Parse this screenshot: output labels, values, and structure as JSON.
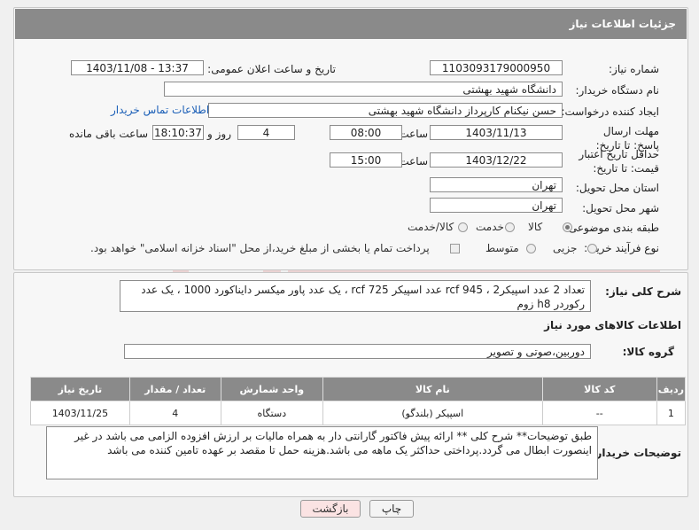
{
  "header": {
    "title": "جزئیات اطلاعات نیاز"
  },
  "fields": {
    "need_number_label": "شماره نیاز:",
    "need_number": "1103093179000950",
    "announce_label": "تاریخ و ساعت اعلان عمومی:",
    "announce_value": "1403/11/08 - 13:37",
    "buyer_label": "نام دستگاه خریدار:",
    "buyer_value": "دانشگاه شهید بهشتی",
    "creator_label": "ایجاد کننده درخواست:",
    "creator_value": "حسن نیکنام کارپرداز دانشگاه شهید بهشتی",
    "contact_link": "اطلاعات تماس خریدار",
    "deadline_label": "مهلت ارسال پاسخ: تا تاریخ:",
    "deadline_date": "1403/11/13",
    "time_label": "ساعت",
    "deadline_time": "08:00",
    "days_value": "4",
    "days_label": "روز و",
    "remaining_time": "18:10:37",
    "remaining_label": "ساعت باقی مانده",
    "validity_label": "حداقل تاریخ اعتبار قیمت: تا تاریخ:",
    "validity_date": "1403/12/22",
    "validity_time_label": "ساعت",
    "validity_time": "15:00",
    "province_label": "استان محل تحویل:",
    "province_value": "تهران",
    "city_label": "شهر محل تحویل:",
    "city_value": "تهران",
    "category_label": "طبقه بندی موضوعی:",
    "category_options": [
      "کالا",
      "خدمت",
      "کالا/خدمت"
    ],
    "process_label": "نوع فرآیند خرید :",
    "process_options": [
      "جزیی",
      "متوسط"
    ],
    "payment_note": "پرداخت تمام یا بخشی از مبلغ خرید،از محل \"اسناد خزانه اسلامی\" خواهد بود."
  },
  "description": {
    "label": "شرح کلی نیاز:",
    "text": "تعداد 2 عدد اسپیکر2 ، rcf 945 عدد اسپیکر rcf 725 ، یک عدد پاور میکسر داینا‌کورد 1000 ، یک عدد رکوردر h8 زوم"
  },
  "goods_section": {
    "title": "اطلاعات کالاهای مورد نیاز",
    "group_label": "گروه کالا:",
    "group_value": "دوربین،صوتی و تصویر"
  },
  "table": {
    "headers": [
      "ردیف",
      "کد کالا",
      "نام کالا",
      "واحد شمارش",
      "تعداد / مقدار",
      "تاریخ نیاز"
    ],
    "rows": [
      [
        "1",
        "--",
        "اسپیکر (بلندگو)",
        "دستگاه",
        "4",
        "1403/11/25"
      ]
    ]
  },
  "buyer_notes": {
    "label": "توضیحات خریدار:",
    "text": "طبق توضیحات** شرح کلی  ** ارائه پیش فاکتور  گارانتی دار به همراه مالیات بر ارزش افزوده الزامی می باشد در غیر اینصورت ابطال می گردد.پرداختی حداکثر یک ماهه می باشد.هزینه حمل تا مقصد بر عهده تامین کننده می باشد"
  },
  "buttons": {
    "print": "چاپ",
    "back": "بازگشت"
  },
  "colors": {
    "header_bg": "#8a8a8a",
    "link": "#1b5fb7",
    "back_bg": "#fbe3e3"
  }
}
